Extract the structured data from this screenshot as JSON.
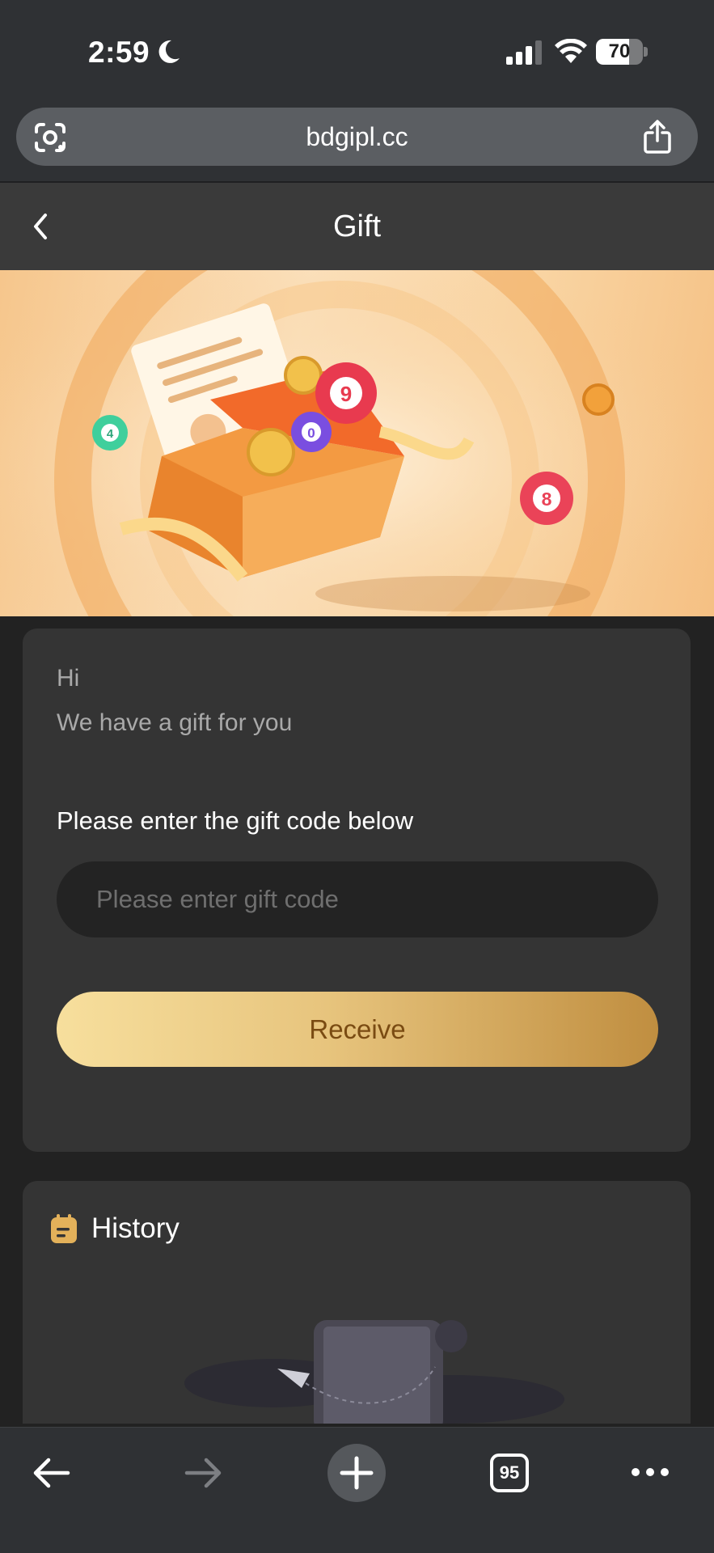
{
  "status_bar": {
    "time": "2:59",
    "battery": "70",
    "battery_level": 0.7
  },
  "browser": {
    "url": "bdgipl.cc",
    "tab_count": "95"
  },
  "header": {
    "title": "Gift"
  },
  "banner": {
    "ball_numbers": [
      "9",
      "0",
      "4",
      "8"
    ]
  },
  "gift_card": {
    "greeting": "Hi",
    "message": "We have a gift for you",
    "prompt": "Please enter the gift code below",
    "input_placeholder": "Please enter gift code",
    "input_value": "",
    "button_label": "Receive"
  },
  "history": {
    "title": "History"
  },
  "colors": {
    "background": "#222222",
    "card": "#343434",
    "accent_gold_start": "#f7df9d",
    "accent_gold_end": "#c08e40",
    "button_text": "#7a4b12",
    "history_icon": "#e3b15a"
  },
  "icons": {
    "status": [
      "moon-icon",
      "signal-icon",
      "wifi-icon",
      "battery-icon"
    ],
    "url_bar": [
      "scan-icon",
      "share-icon"
    ],
    "header": [
      "chevron-left-icon"
    ],
    "toolbar": [
      "arrow-left-icon",
      "arrow-right-icon",
      "plus-icon",
      "tabs-icon",
      "more-icon"
    ]
  }
}
